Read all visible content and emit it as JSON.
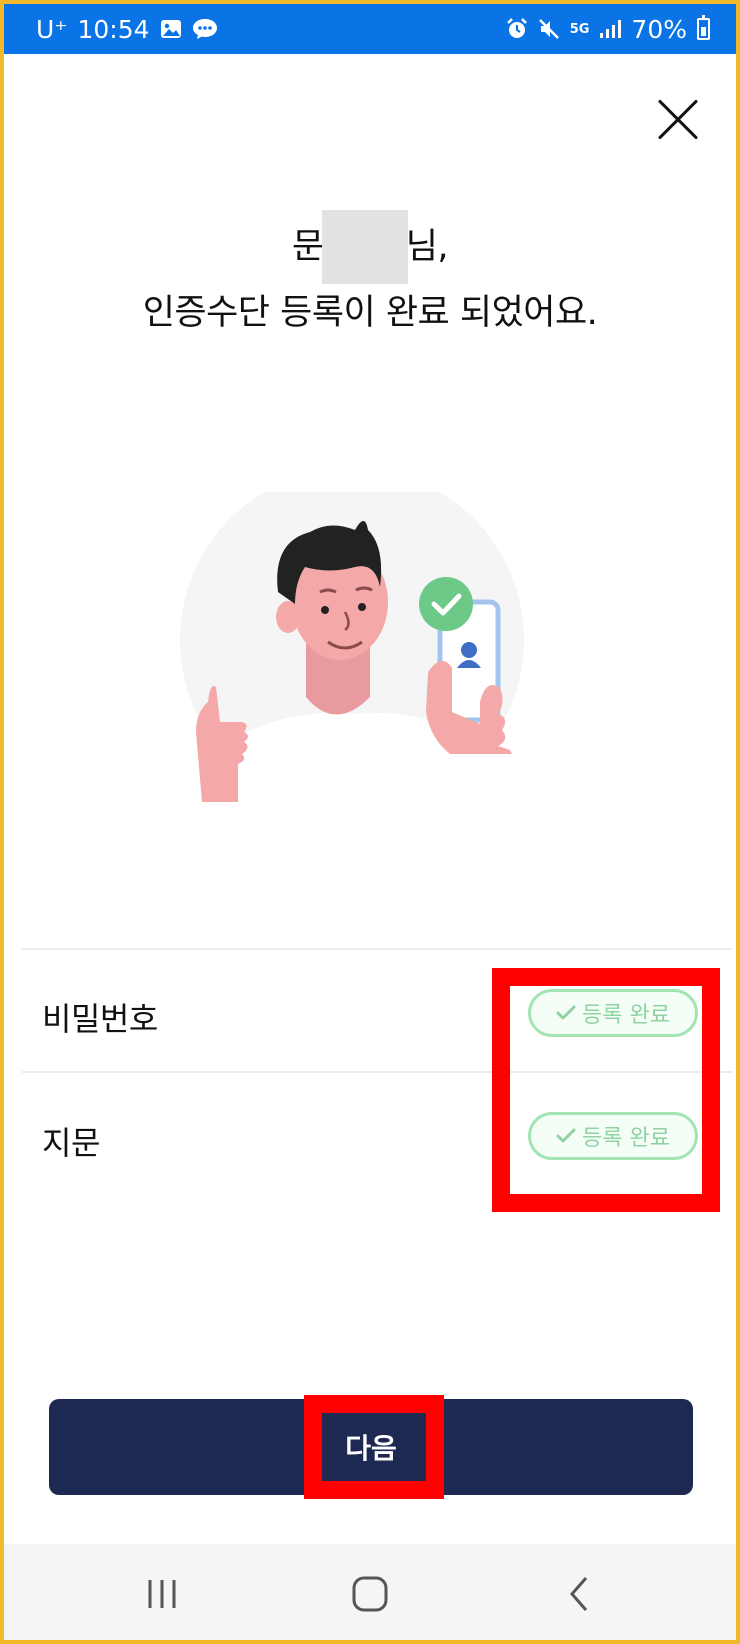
{
  "status_bar": {
    "carrier": "U⁺",
    "time": "10:54",
    "network": "5G",
    "battery": "70%",
    "icons": [
      "gallery-icon",
      "message-icon",
      "alarm-icon",
      "mute-icon",
      "signal-icon",
      "battery-icon"
    ]
  },
  "header": {
    "greeting_prefix": "문",
    "greeting_suffix": "님,",
    "subtitle": "인증수단 등록이 완료 되었어요."
  },
  "methods": [
    {
      "label": "비밀번호",
      "status": "등록 완료"
    },
    {
      "label": "지문",
      "status": "등록 완료"
    }
  ],
  "next_button": {
    "label": "다음"
  },
  "colors": {
    "status_bar": "#0a73e6",
    "button": "#1d2951",
    "badge_border": "#a3e4b3",
    "badge_text": "#8fd3a1",
    "highlight": "#ff0000",
    "frame": "#f2b92b"
  },
  "nav": {
    "icons": [
      "recent-apps-icon",
      "home-icon",
      "back-icon"
    ]
  }
}
